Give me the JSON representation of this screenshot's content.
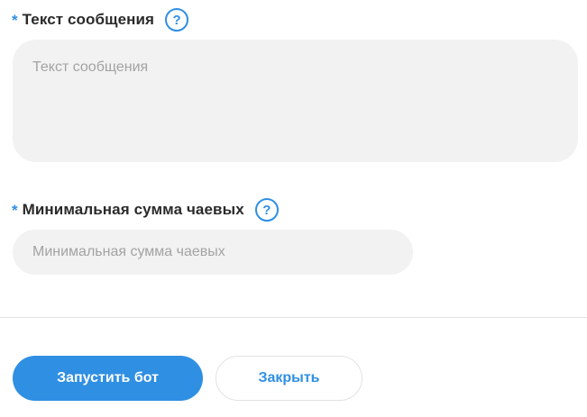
{
  "form": {
    "message_field": {
      "required_mark": "*",
      "label": "Текст сообщения",
      "help": "?",
      "placeholder": "Текст сообщения",
      "value": ""
    },
    "tip_field": {
      "required_mark": "*",
      "label": "Минимальная сумма чаевых",
      "help": "?",
      "placeholder": "Минимальная сумма чаевых",
      "value": ""
    }
  },
  "actions": {
    "start_label": "Запустить бот",
    "close_label": "Закрыть"
  },
  "icons": {
    "help": "question-circle-icon"
  },
  "colors": {
    "accent": "#2f8fe3",
    "input_bg": "#f2f2f2",
    "label_text": "#2a2a2a",
    "placeholder": "#a3a3a3",
    "divider": "#e3e3e3"
  }
}
